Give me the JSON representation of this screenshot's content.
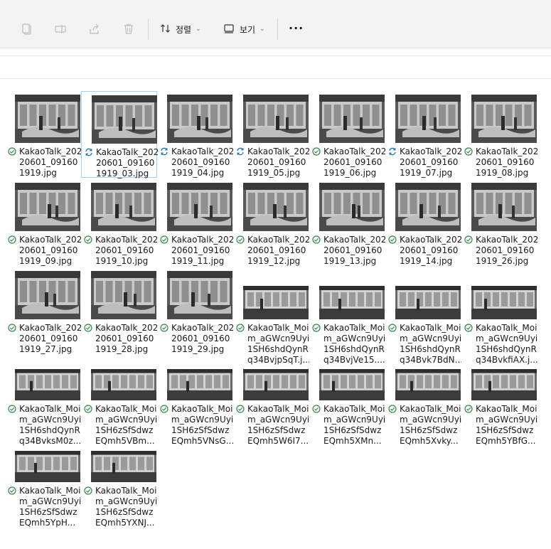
{
  "toolbar": {
    "sort_label": "정렬",
    "view_label": "보기",
    "more_label": "···"
  },
  "files": [
    {
      "lines": [
        "KakaoTalk_202",
        "20601_09160",
        "1919.jpg"
      ],
      "status": "synced",
      "thumb": "tall",
      "selected": false
    },
    {
      "lines": [
        "KakaoTalk_202",
        "20601_09160",
        "1919_03.jpg"
      ],
      "status": "syncing",
      "thumb": "tall",
      "selected": true
    },
    {
      "lines": [
        "KakaoTalk_202",
        "20601_09160",
        "1919_04.jpg"
      ],
      "status": "syncing",
      "thumb": "tall",
      "selected": false
    },
    {
      "lines": [
        "KakaoTalk_202",
        "20601_09160",
        "1919_05.jpg"
      ],
      "status": "syncing",
      "thumb": "tall",
      "selected": false
    },
    {
      "lines": [
        "KakaoTalk_202",
        "20601_09160",
        "1919_06.jpg"
      ],
      "status": "synced",
      "thumb": "tall",
      "selected": false
    },
    {
      "lines": [
        "KakaoTalk_202",
        "20601_09160",
        "1919_07.jpg"
      ],
      "status": "syncing",
      "thumb": "tall",
      "selected": false
    },
    {
      "lines": [
        "KakaoTalk_202",
        "20601_09160",
        "1919_08.jpg"
      ],
      "status": "synced",
      "thumb": "tall",
      "selected": false
    },
    {
      "lines": [
        "KakaoTalk_202",
        "20601_09160",
        "1919_09.jpg"
      ],
      "status": "synced",
      "thumb": "tall",
      "selected": false
    },
    {
      "lines": [
        "KakaoTalk_202",
        "20601_09160",
        "1919_10.jpg"
      ],
      "status": "synced",
      "thumb": "tall",
      "selected": false
    },
    {
      "lines": [
        "KakaoTalk_202",
        "20601_09160",
        "1919_11.jpg"
      ],
      "status": "synced",
      "thumb": "tall",
      "selected": false
    },
    {
      "lines": [
        "KakaoTalk_202",
        "20601_09160",
        "1919_12.jpg"
      ],
      "status": "synced",
      "thumb": "tall",
      "selected": false
    },
    {
      "lines": [
        "KakaoTalk_202",
        "20601_09160",
        "1919_13.jpg"
      ],
      "status": "synced",
      "thumb": "tall",
      "selected": false
    },
    {
      "lines": [
        "KakaoTalk_202",
        "20601_09160",
        "1919_14.jpg"
      ],
      "status": "synced",
      "thumb": "tall",
      "selected": false
    },
    {
      "lines": [
        "KakaoTalk_202",
        "20601_09160",
        "1919_26.jpg"
      ],
      "status": "synced",
      "thumb": "tall",
      "selected": false
    },
    {
      "lines": [
        "KakaoTalk_202",
        "20601_09160",
        "1919_27.jpg"
      ],
      "status": "synced",
      "thumb": "tall",
      "selected": false
    },
    {
      "lines": [
        "KakaoTalk_202",
        "20601_09160",
        "1919_28.jpg"
      ],
      "status": "synced",
      "thumb": "tall",
      "selected": false
    },
    {
      "lines": [
        "KakaoTalk_202",
        "20601_09160",
        "1919_29.jpg"
      ],
      "status": "synced",
      "thumb": "tall",
      "selected": false
    },
    {
      "lines": [
        "KakaoTalk_Moi",
        "m_aGWcn9Uyi",
        "1SH6shdQynR",
        "q34BvjpSqT.j..."
      ],
      "status": "synced",
      "thumb": "wide",
      "selected": false
    },
    {
      "lines": [
        "KakaoTalk_Moi",
        "m_aGWcn9Uyi",
        "1SH6shdQynR",
        "q34BvjVe15...."
      ],
      "status": "synced",
      "thumb": "wide",
      "selected": false
    },
    {
      "lines": [
        "KakaoTalk_Moi",
        "m_aGWcn9Uyi",
        "1SH6shdQynR",
        "q34Bvk7BdN..."
      ],
      "status": "synced",
      "thumb": "wide",
      "selected": false
    },
    {
      "lines": [
        "KakaoTalk_Moi",
        "m_aGWcn9Uyi",
        "1SH6shdQynR",
        "q34BvkfiAX.j..."
      ],
      "status": "synced",
      "thumb": "wide",
      "selected": false
    },
    {
      "lines": [
        "KakaoTalk_Moi",
        "m_aGWcn9Uyi",
        "1SH6shdQynR",
        "q34BvksM0z..."
      ],
      "status": "synced",
      "thumb": "wide",
      "selected": false
    },
    {
      "lines": [
        "KakaoTalk_Moi",
        "m_aGWcn9Uyi",
        "1SH6zSfSdwz",
        "EQmh5VBm..."
      ],
      "status": "synced",
      "thumb": "wide",
      "selected": false
    },
    {
      "lines": [
        "KakaoTalk_Moi",
        "m_aGWcn9Uyi",
        "1SH6zSfSdwz",
        "EQmh5VNsG..."
      ],
      "status": "synced",
      "thumb": "wide",
      "selected": false
    },
    {
      "lines": [
        "KakaoTalk_Moi",
        "m_aGWcn9Uyi",
        "1SH6zSfSdwz",
        "EQmh5W6I7..."
      ],
      "status": "synced",
      "thumb": "wide",
      "selected": false
    },
    {
      "lines": [
        "KakaoTalk_Moi",
        "m_aGWcn9Uyi",
        "1SH6zSfSdwz",
        "EQmh5XMn..."
      ],
      "status": "synced",
      "thumb": "wide",
      "selected": false
    },
    {
      "lines": [
        "KakaoTalk_Moi",
        "m_aGWcn9Uyi",
        "1SH6zSfSdwz",
        "EQmh5Xvky..."
      ],
      "status": "synced",
      "thumb": "wide",
      "selected": false
    },
    {
      "lines": [
        "KakaoTalk_Moi",
        "m_aGWcn9Uyi",
        "1SH6zSfSdwz",
        "EQmh5YBfG..."
      ],
      "status": "synced",
      "thumb": "wide",
      "selected": false
    },
    {
      "lines": [
        "KakaoTalk_Moi",
        "m_aGWcn9Uyi",
        "1SH6zSfSdwz",
        "EQmh5YpH..."
      ],
      "status": "synced",
      "thumb": "wide",
      "selected": false
    },
    {
      "lines": [
        "KakaoTalk_Moi",
        "m_aGWcn9Uyi",
        "1SH6zSfSdwz",
        "EQmh5YXNJ..."
      ],
      "status": "synced",
      "thumb": "wide",
      "selected": false
    }
  ],
  "colors": {
    "synced": "#2e8b45",
    "syncing": "#0f6cbd",
    "selection_border": "#99d1ff"
  }
}
